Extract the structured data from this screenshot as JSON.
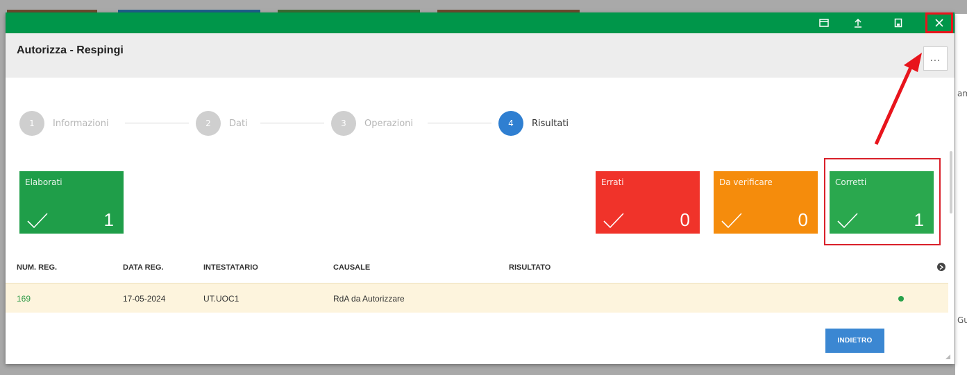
{
  "dialog": {
    "title": "Autorizza - Respingi",
    "more_label": "...",
    "accent": "#00964a"
  },
  "steps": [
    {
      "number": "1",
      "label": "Informazioni"
    },
    {
      "number": "2",
      "label": "Dati"
    },
    {
      "number": "3",
      "label": "Operazioni"
    },
    {
      "number": "4",
      "label": "Risultati"
    }
  ],
  "tiles": {
    "elaborati": {
      "label": "Elaborati",
      "count": "1",
      "color": "#1f9e49"
    },
    "errati": {
      "label": "Errati",
      "count": "0",
      "color": "#f0332a"
    },
    "da_verificare": {
      "label": "Da verificare",
      "count": "0",
      "color": "#f58c0c"
    },
    "corretti": {
      "label": "Corretti",
      "count": "1",
      "color": "#2aa84e"
    }
  },
  "table": {
    "columns": [
      "NUM. REG.",
      "DATA REG.",
      "INTESTATARIO",
      "CAUSALE",
      "RISULTATO"
    ],
    "rows": [
      {
        "num_reg": "169",
        "data_reg": "17-05-2024",
        "intestatario": "UT.UOC1",
        "causale": "RdA da Autorizzare",
        "status_color": "#27a14a"
      }
    ]
  },
  "buttons": {
    "back": "INDIETRO"
  },
  "background": {
    "side_text_top": "am",
    "side_text_bottom": "Gu"
  }
}
